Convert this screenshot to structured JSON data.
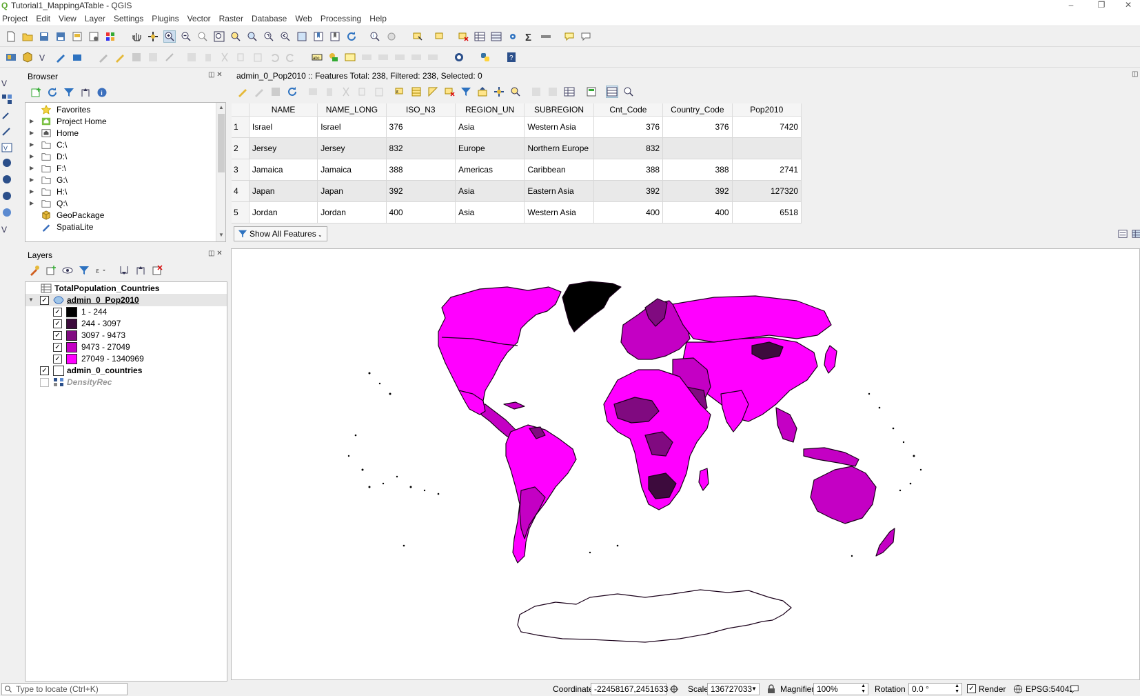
{
  "window": {
    "title": "Tutorial1_MappingATable - QGIS",
    "minimize": "–",
    "restore": "❐",
    "close": "✕"
  },
  "menu": [
    "Project",
    "Edit",
    "View",
    "Layer",
    "Settings",
    "Plugins",
    "Vector",
    "Raster",
    "Database",
    "Web",
    "Processing",
    "Help"
  ],
  "browser": {
    "title": "Browser",
    "items": [
      {
        "label": "Favorites",
        "icon": "star-icon"
      },
      {
        "label": "Project Home",
        "icon": "project-home-icon"
      },
      {
        "label": "Home",
        "icon": "home-icon"
      },
      {
        "label": "C:\\",
        "icon": "folder-icon"
      },
      {
        "label": "D:\\",
        "icon": "folder-icon"
      },
      {
        "label": "F:\\",
        "icon": "folder-icon"
      },
      {
        "label": "G:\\",
        "icon": "folder-icon"
      },
      {
        "label": "H:\\",
        "icon": "folder-icon"
      },
      {
        "label": "Q:\\",
        "icon": "folder-icon"
      },
      {
        "label": "GeoPackage",
        "icon": "geopackage-icon"
      },
      {
        "label": "SpatiaLite",
        "icon": "spatialite-icon"
      }
    ]
  },
  "layers": {
    "title": "Layers",
    "items": [
      {
        "label": "TotalPopulation_Countries",
        "type": "table"
      },
      {
        "label": "admin_0_Pop2010",
        "type": "group"
      },
      {
        "label": "admin_0_countries",
        "type": "polygon"
      },
      {
        "label": "DensityRec",
        "type": "raster"
      }
    ],
    "legend": [
      {
        "label": "1 - 244",
        "color": "#000000"
      },
      {
        "label": "244 - 3097",
        "color": "#3d0b3d"
      },
      {
        "label": "3097 - 9473",
        "color": "#800a80"
      },
      {
        "label": "9473 - 27049",
        "color": "#c400c4"
      },
      {
        "label": "27049 - 1340969",
        "color": "#ff00ff"
      }
    ]
  },
  "attribute_table": {
    "title": "admin_0_Pop2010 :: Features Total: 238, Filtered: 238, Selected: 0",
    "columns": [
      "NAME",
      "NAME_LONG",
      "ISO_N3",
      "REGION_UN",
      "SUBREGION",
      "Cnt_Code",
      "Country_Code",
      "Pop2010"
    ],
    "rows": [
      {
        "n": "1",
        "cells": [
          "Israel",
          "Israel",
          "376",
          "Asia",
          "Western Asia",
          "376",
          "376",
          "7420"
        ]
      },
      {
        "n": "2",
        "cells": [
          "Jersey",
          "Jersey",
          "832",
          "Europe",
          "Northern Europe",
          "832",
          "",
          ""
        ]
      },
      {
        "n": "3",
        "cells": [
          "Jamaica",
          "Jamaica",
          "388",
          "Americas",
          "Caribbean",
          "388",
          "388",
          "2741"
        ]
      },
      {
        "n": "4",
        "cells": [
          "Japan",
          "Japan",
          "392",
          "Asia",
          "Eastern Asia",
          "392",
          "392",
          "127320"
        ]
      },
      {
        "n": "5",
        "cells": [
          "Jordan",
          "Jordan",
          "400",
          "Asia",
          "Western Asia",
          "400",
          "400",
          "6518"
        ]
      }
    ],
    "show_all": "Show All Features"
  },
  "statusbar": {
    "locate_placeholder": "Type to locate (Ctrl+K)",
    "coordinate_label": "Coordinate",
    "coordinate_value": "-22458167,2451633",
    "scale_label": "Scale",
    "scale_value": "136727033",
    "magnifier_label": "Magnifier",
    "magnifier_value": "100%",
    "rotation_label": "Rotation",
    "rotation_value": "0.0 °",
    "render_label": "Render",
    "crs": "EPSG:54042"
  },
  "colors": {
    "accent": "#ff00ff",
    "selection": "#cde"
  }
}
